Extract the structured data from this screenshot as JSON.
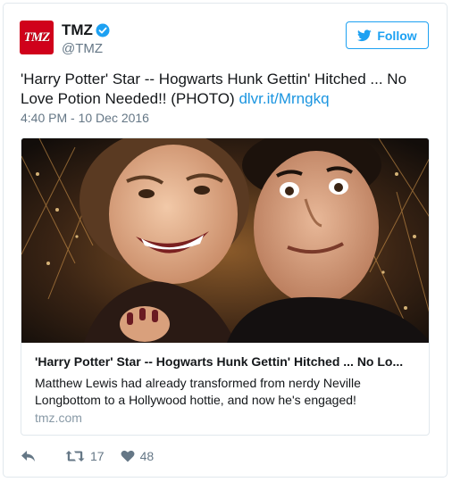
{
  "account": {
    "name": "TMZ",
    "handle": "@TMZ",
    "avatar_text": "TMZ",
    "verified_icon": "verified-badge-icon"
  },
  "follow_label": "Follow",
  "tweet": {
    "text": "'Harry Potter' Star -- Hogwarts Hunk Gettin' Hitched ... No Love Potion Needed!! (PHOTO)",
    "link_text": "dlvr.it/Mrngkq",
    "timestamp": "4:40 PM - 10 Dec 2016"
  },
  "link_card": {
    "title": "'Harry Potter' Star -- Hogwarts Hunk Gettin' Hitched ... No Lo...",
    "description": "Matthew Lewis had already transformed from nerdy Neville Longbottom to a Hollywood hottie, and now he's engaged!",
    "domain": "tmz.com"
  },
  "actions": {
    "reply_icon": "reply-icon",
    "retweet_icon": "retweet-icon",
    "retweet_count": "17",
    "like_icon": "heart-icon",
    "like_count": "48"
  },
  "colors": {
    "brand_blue": "#1da1f2",
    "link_blue": "#1b95e0",
    "tmz_red": "#d0011b",
    "muted": "#657786"
  }
}
